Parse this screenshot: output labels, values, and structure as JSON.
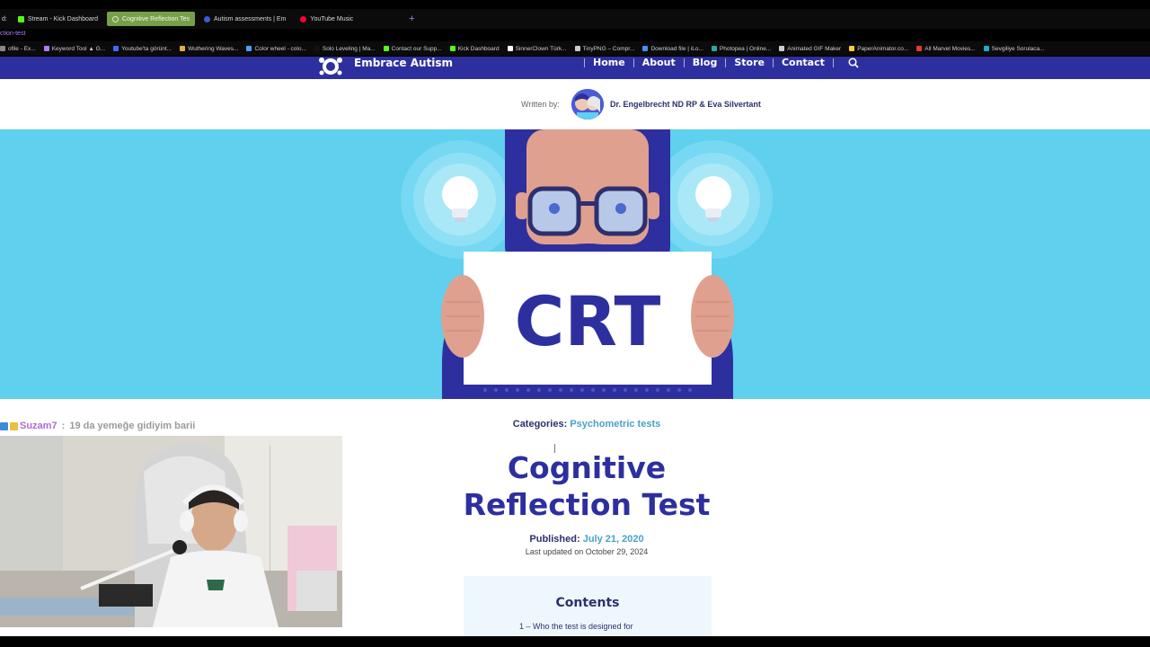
{
  "tabs": [
    {
      "label": "Stream - Kick Dashboard",
      "favicon_color": "#53fc18",
      "active": false
    },
    {
      "label": "Cognitive Reflection Tes",
      "favicon_color": "#dfe8cf",
      "active": true
    },
    {
      "label": "Autism assessments | Em",
      "favicon_color": "#3b5bd6",
      "active": false
    },
    {
      "label": "YouTube Music",
      "favicon_color": "#ff0033",
      "active": false
    }
  ],
  "tab_prefix": "d:",
  "new_tab_symbol": "+",
  "url_fragment": "ction-test",
  "bookmarks": [
    {
      "label": "ofile - Ex...",
      "favicon_color": "#888888"
    },
    {
      "label": "Keyword Tool ▲ G...",
      "favicon_color": "#b07cff"
    },
    {
      "label": "Youtube'ta görünt...",
      "favicon_color": "#3b6cff"
    },
    {
      "label": "Wuthering Waves...",
      "favicon_color": "#e0b040"
    },
    {
      "label": "Color wheel - colo...",
      "favicon_color": "#4aa0ff"
    },
    {
      "label": "Solo Leveling | Ma...",
      "favicon_color": "#111111"
    },
    {
      "label": "Contact our Supp...",
      "favicon_color": "#53fc18"
    },
    {
      "label": "Kick Dashboard",
      "favicon_color": "#53fc18"
    },
    {
      "label": "SinnerClown Türk...",
      "favicon_color": "#ffffff"
    },
    {
      "label": "TinyPNG – Compr...",
      "favicon_color": "#cccccc"
    },
    {
      "label": "Download file | iLo...",
      "favicon_color": "#4a8cff"
    },
    {
      "label": "Photopea | Online...",
      "favicon_color": "#2aa7a0"
    },
    {
      "label": "Animated GIF Maker",
      "favicon_color": "#cccccc"
    },
    {
      "label": "PaperAnimator.co...",
      "favicon_color": "#ffcc33"
    },
    {
      "label": "All Marvel Movies...",
      "favicon_color": "#e23b2a"
    },
    {
      "label": "Sevgiliye Sorulaca...",
      "favicon_color": "#22aacc"
    }
  ],
  "site": {
    "logo_text": "Embrace Autism",
    "menu": [
      "Home",
      "About",
      "Blog",
      "Store",
      "Contact"
    ],
    "written_by_label": "Written by:",
    "authors": "Dr. Engelbrecht ND RP & Eva Silvertant",
    "hero_text": "CRT",
    "categories_label": "Categories:",
    "categories_value": "Psychometric tests",
    "title_line1": "Cognitive",
    "title_line2": "Reflection Test",
    "published_label": "Published:",
    "published_date": "July 21, 2020",
    "last_updated": "Last updated on October 29, 2024",
    "toc_title": "Contents",
    "toc_first_item": "1 – Who the test is designed for"
  },
  "colors": {
    "nav_bg": "#2e2f9e",
    "hero_bg": "#5fd0ee",
    "title": "#2e2f9e",
    "link": "#4aa0c8",
    "active_tab": "#76a04a"
  },
  "chat": {
    "user": "Suzam7",
    "separator": " : ",
    "message": "19 da yemeğe gidiyim barii"
  }
}
